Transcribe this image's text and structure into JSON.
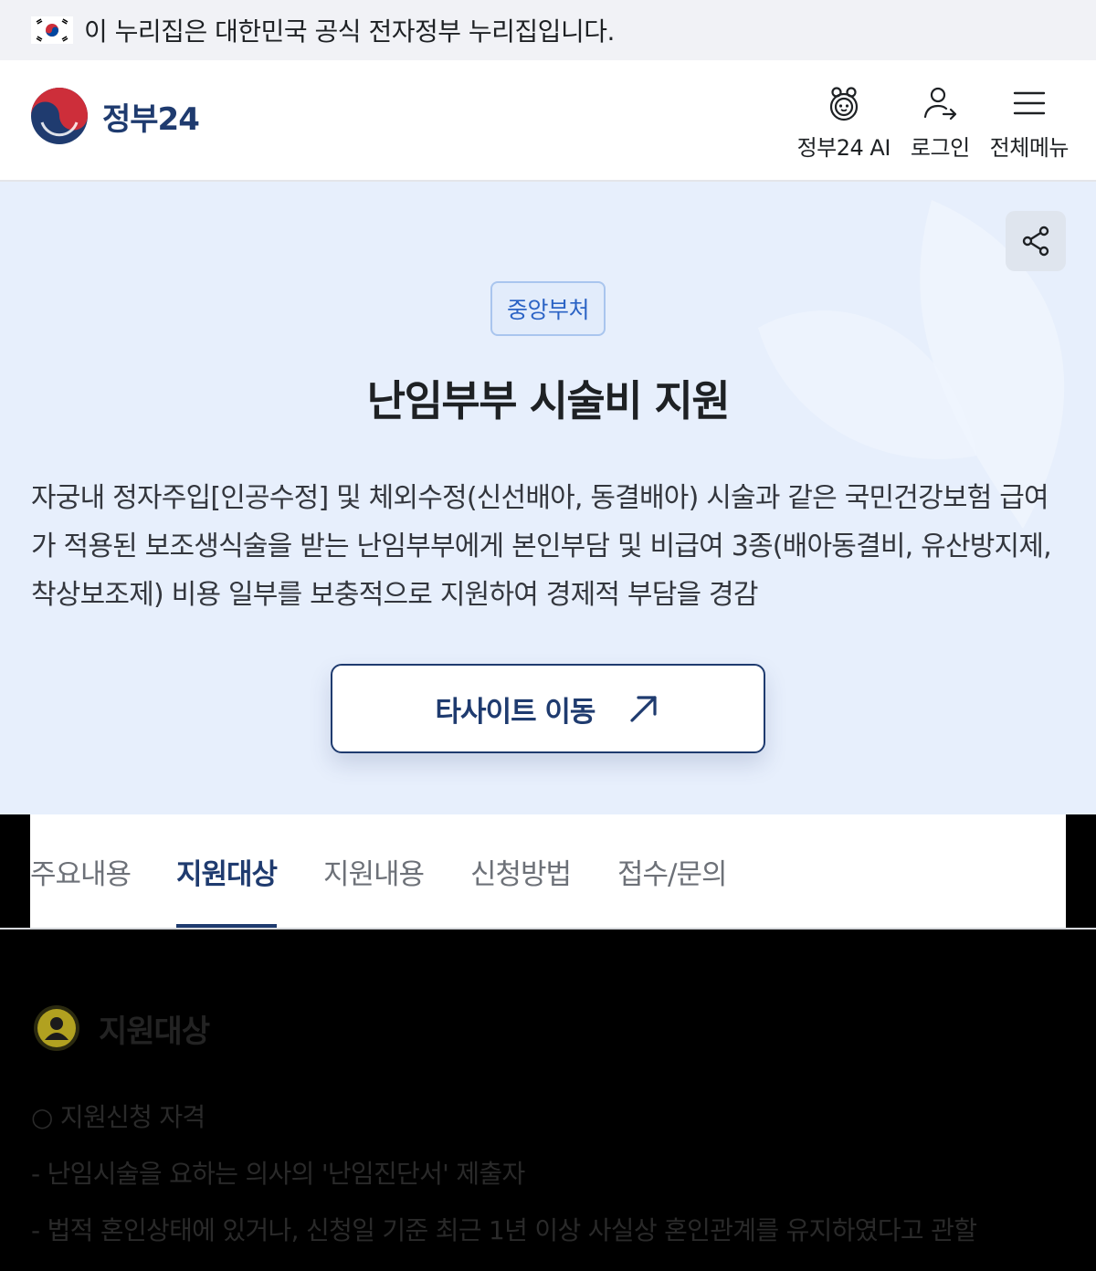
{
  "gov_banner": {
    "text": "이 누리집은 대한민국 공식 전자정부 누리집입니다."
  },
  "header": {
    "logo_text": "정부24",
    "nav": [
      {
        "label": "정부24 AI",
        "icon": "ai-character-icon"
      },
      {
        "label": "로그인",
        "icon": "login-icon"
      },
      {
        "label": "전체메뉴",
        "icon": "menu-icon"
      }
    ]
  },
  "hero": {
    "badge": "중앙부처",
    "title": "난임부부 시술비 지원",
    "description": "자궁내 정자주입[인공수정] 및 체외수정(신선배아, 동결배아) 시술과 같은 국민건강보험 급여가 적용된 보조생식술을 받는 난임부부에게 본인부담 및 비급여 3종(배아동결비, 유산방지제, 착상보조제) 비용 일부를 보충적으로 지원하여 경제적 부담을 경감",
    "site_button": "타사이트 이동"
  },
  "tabs": [
    {
      "label": "주요내용",
      "active": false
    },
    {
      "label": "지원대상",
      "active": true
    },
    {
      "label": "지원내용",
      "active": false
    },
    {
      "label": "신청방법",
      "active": false
    },
    {
      "label": "접수/문의",
      "active": false
    }
  ],
  "content": {
    "section_title": "지원대상",
    "items": [
      "○ 지원신청 자격",
      "- 난임시술을 요하는 의사의 '난임진단서' 제출자",
      "- 법적 혼인상태에 있거나, 신청일 기준 최근 1년 이상 사실상 혼인관계를 유지하였다고 관할"
    ]
  },
  "colors": {
    "brand_navy": "#1f3b6f",
    "hero_bg": "#e7effc",
    "badge_blue": "#2b63c5"
  }
}
